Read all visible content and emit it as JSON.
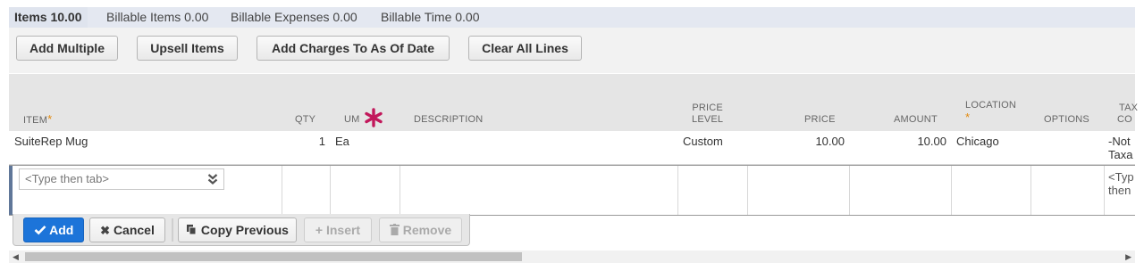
{
  "tabs": [
    {
      "label": "Items 10.00",
      "active": true
    },
    {
      "label": "Billable Items 0.00"
    },
    {
      "label": "Billable Expenses 0.00"
    },
    {
      "label": "Billable Time 0.00"
    }
  ],
  "toolbar": {
    "add_multiple": "Add Multiple",
    "upsell_items": "Upsell Items",
    "add_charges": "Add Charges To As Of Date",
    "clear_all": "Clear All Lines"
  },
  "columns": {
    "item": "ITEM",
    "qty": "QTY",
    "um": "UM",
    "description": "DESCRIPTION",
    "price_level_1": "PRICE",
    "price_level_2": "LEVEL",
    "price": "PRICE",
    "amount": "AMOUNT",
    "location": "LOCATION",
    "options": "OPTIONS",
    "tax_code_1": "TAX",
    "tax_code_2": "CO",
    "required_mark": "*"
  },
  "row": {
    "item": "SuiteRep Mug",
    "qty": "1",
    "um": "Ea",
    "description": "",
    "price_level": "Custom",
    "price": "10.00",
    "amount": "10.00",
    "location": "Chicago",
    "tax_code_1": "-Not",
    "tax_code_2": "Taxa"
  },
  "edit_row": {
    "item_placeholder": "<Type then tab>",
    "tax_placeholder_1": "<Typ",
    "tax_placeholder_2": "then"
  },
  "actions": {
    "add": "Add",
    "cancel": "Cancel",
    "copy_previous": "Copy Previous",
    "insert": "Insert",
    "remove": "Remove"
  },
  "colors": {
    "primary": "#1c74d9",
    "required_star": "#e38a0e",
    "um_marker": "#c2185b"
  }
}
